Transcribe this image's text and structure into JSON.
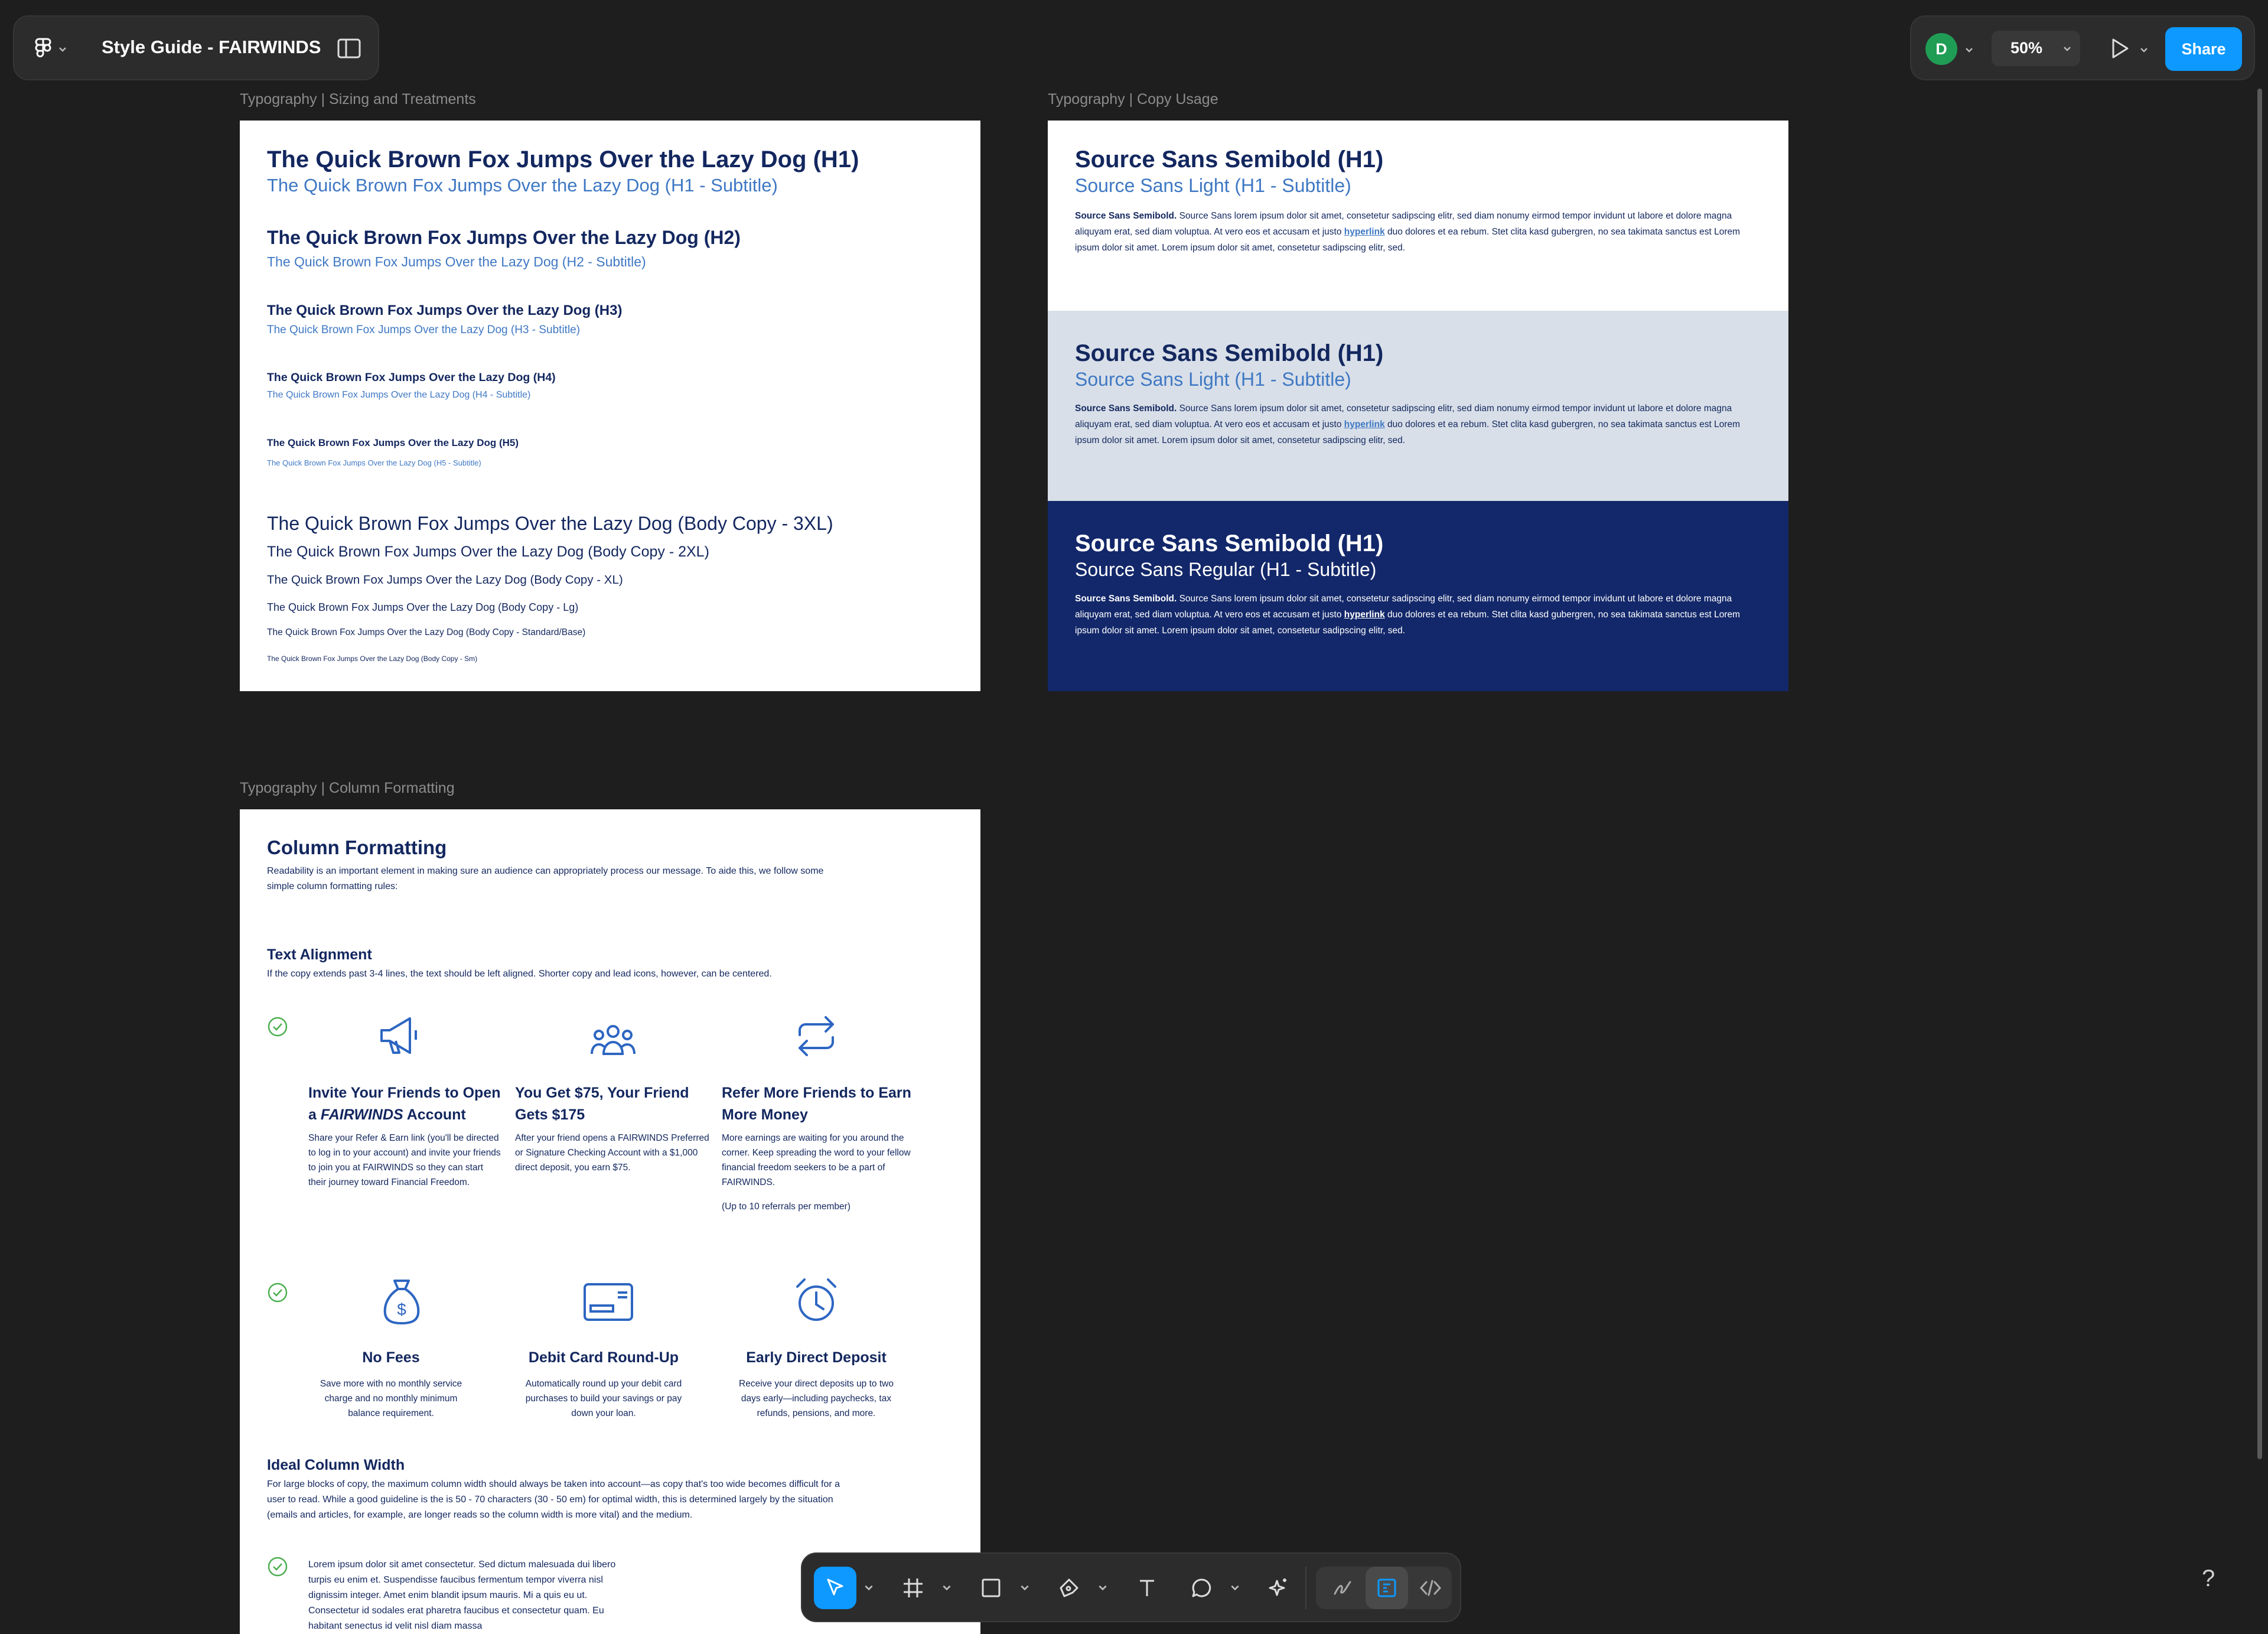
{
  "header": {
    "file_title": "Style Guide - FAIRWINDS",
    "avatar_initial": "D",
    "zoom": "50%",
    "share_label": "Share"
  },
  "frames": {
    "sizing": {
      "label": "Typography | Sizing and Treatments",
      "h1": "The Quick Brown Fox Jumps Over the Lazy Dog (H1)",
      "h1_sub": "The Quick Brown Fox Jumps Over the Lazy Dog (H1 - Subtitle)",
      "h2": "The Quick Brown Fox Jumps Over the Lazy Dog (H2)",
      "h2_sub": "The Quick Brown Fox Jumps Over the Lazy Dog (H2 - Subtitle)",
      "h3": "The Quick Brown Fox Jumps Over the Lazy Dog (H3)",
      "h3_sub": "The Quick Brown Fox Jumps Over the Lazy Dog (H3 - Subtitle)",
      "h4": "The Quick Brown Fox Jumps Over the Lazy Dog (H4)",
      "h4_sub": "The Quick Brown Fox Jumps Over the Lazy Dog (H4 - Subtitle)",
      "h5": "The Quick Brown Fox Jumps Over the Lazy Dog (H5)",
      "h5_sub": "The Quick Brown Fox Jumps Over the Lazy Dog (H5 - Subtitle)",
      "body_3xl": "The Quick Brown Fox Jumps Over the Lazy Dog (Body Copy - 3XL)",
      "body_2xl": "The Quick Brown Fox Jumps Over the Lazy Dog (Body Copy - 2XL)",
      "body_xl": "The Quick Brown Fox Jumps Over the Lazy Dog (Body Copy - XL)",
      "body_lg": "The Quick Brown Fox Jumps Over the Lazy Dog (Body Copy - Lg)",
      "body_std": "The Quick Brown Fox Jumps Over the Lazy Dog (Body Copy - Standard/Base)",
      "body_sm": "The Quick Brown Fox Jumps Over the Lazy Dog (Body Copy - Sm)"
    },
    "copy_usage": {
      "label": "Typography | Copy Usage",
      "h1": "Source Sans Semibold (H1)",
      "sub_light": "Source Sans Light (H1 - Subtitle)",
      "sub_regular": "Source Sans Regular (H1 - Subtitle)",
      "para_lead": "Source Sans Semibold.",
      "para_a": " Source Sans lorem ipsum dolor sit amet, consetetur sadipscing elitr, sed diam nonumy eirmod tempor invidunt ut labore et dolore magna aliquyam erat, sed diam voluptua. At vero eos et accusam et justo ",
      "hyperlink": "hyperlink",
      "para_b": " duo dolores et ea rebum. Stet clita kasd gubergren, no sea takimata sanctus est Lorem ipsum dolor sit amet. Lorem ipsum dolor sit amet, consetetur sadipscing elitr, sed.",
      "colors": {
        "band1": "#ffffff",
        "band2": "#d8dfe8",
        "band3": "#13286a"
      }
    },
    "columns": {
      "label": "Typography | Column Formatting",
      "title": "Column Formatting",
      "intro": "Readability is an important element in making sure an audience can appropriately process our message. To aide this, we follow some simple column formatting rules:",
      "text_alignment": "Text Alignment",
      "alignment_desc": "If the copy extends past 3-4 lines, the text should be left aligned. Shorter copy and lead icons, however, can be centered.",
      "features_left": [
        {
          "icon": "megaphone-icon",
          "title_a": "Invite Your Friends to Open a ",
          "title_em": "FAIRWINDS",
          "title_b": " Account",
          "body": "Share your Refer & Earn link (you'll be directed to log in to your account) and invite your friends to join you at FAIRWINDS so they can start their journey toward Financial Freedom."
        },
        {
          "icon": "people-icon",
          "title": "You Get $75, Your Friend Gets $175",
          "body": "After your friend opens a FAIRWINDS Preferred or Signature Checking Account with a $1,000 direct deposit, you earn $75."
        },
        {
          "icon": "repeat-icon",
          "title": "Refer More Friends to Earn More Money",
          "body": "More earnings are waiting for you around the corner. Keep spreading  the word to your fellow financial freedom seekers to be a part of FAIRWINDS.",
          "note": "(Up to 10 referrals per member)"
        }
      ],
      "features_center": [
        {
          "icon": "money-bag-icon",
          "title": "No Fees",
          "body": "Save more with no monthly service charge and no monthly minimum balance requirement."
        },
        {
          "icon": "debit-card-icon",
          "title": "Debit Card Round-Up",
          "body": "Automatically round up your debit card purchases to build your savings or pay down your loan."
        },
        {
          "icon": "alarm-clock-icon",
          "title": "Early Direct Deposit",
          "body": "Receive your direct deposits up to two days early—including paychecks, tax refunds, pensions, and more."
        }
      ],
      "ideal_width": "Ideal Column Width",
      "ideal_desc": "For large blocks of copy, the maximum column width should always be taken into account—as copy that's too wide becomes difficult for a user to read. While a good guideline is the is 50 - 70 characters (30 - 50 em) for optimal width, this is determined largely by the situation (emails and articles, for example, are longer reads so the column width is more vital) and the medium.",
      "lorem": "Lorem ipsum dolor sit amet consectetur. Sed dictum malesuada dui libero turpis eu enim et. Suspendisse faucibus fermentum tempor viverra nisl dignissim integer. Amet enim blandit ipsum mauris. Mi a quis eu ut. Consectetur id sodales erat pharetra faucibus et consectetur quam. Eu habitant senectus id velit nisl diam massa"
    }
  },
  "toolbar": {
    "tools": [
      "move-tool",
      "frame-tool",
      "shape-tool",
      "pen-tool",
      "text-tool",
      "comment-tool",
      "ai-tool"
    ],
    "help": "?"
  }
}
